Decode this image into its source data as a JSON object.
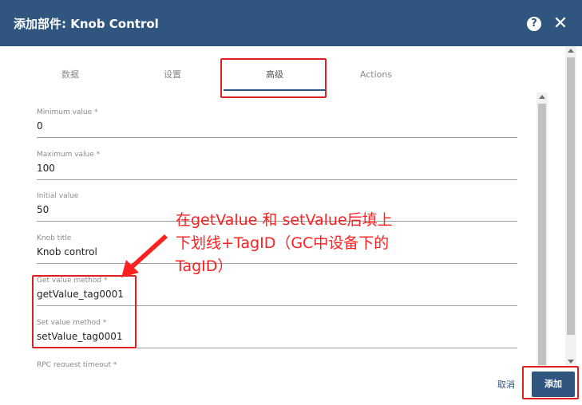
{
  "dialog": {
    "title": "添加部件: Knob Control",
    "help_icon": "?",
    "close_icon": "✕"
  },
  "tabs": [
    {
      "label": "数据",
      "active": false
    },
    {
      "label": "设置",
      "active": false
    },
    {
      "label": "高级",
      "active": true
    },
    {
      "label": "Actions",
      "active": false
    }
  ],
  "fields": {
    "min": {
      "label": "Minimum value *",
      "value": "0"
    },
    "max": {
      "label": "Maximum value *",
      "value": "100"
    },
    "initial": {
      "label": "Initial value",
      "value": "50"
    },
    "knob_title": {
      "label": "Knob title",
      "value": "Knob control"
    },
    "get_method": {
      "label": "Get value method *",
      "value": "getValue_tag0001"
    },
    "set_method": {
      "label": "Set value method *",
      "value": "setValue_tag0001"
    },
    "rpc_timeout": {
      "label": "RPC request timeout *"
    }
  },
  "footer": {
    "cancel_label": "取消",
    "add_label": "添加"
  },
  "annotation": {
    "line1": "在getValue 和 setValue后填上",
    "line2": "下划线+TagID（GC中设备下的",
    "line3": "TagID）"
  },
  "colors": {
    "header": "#305680",
    "annotation": "#ff2020",
    "highlight_box": "#e02020"
  }
}
